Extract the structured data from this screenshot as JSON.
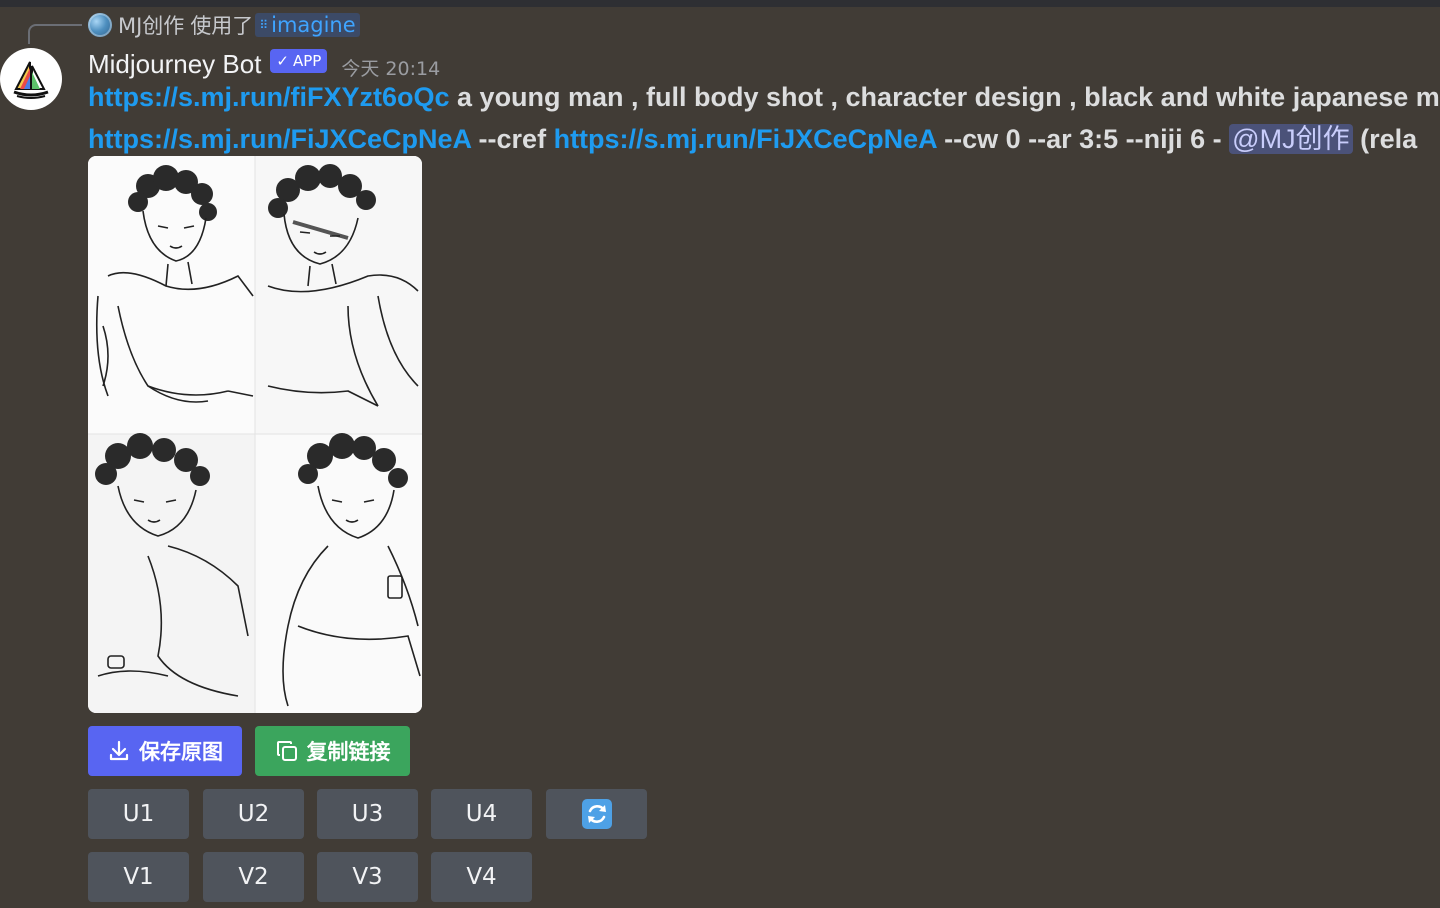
{
  "reply": {
    "user": "MJ创作",
    "used_text": "使用了",
    "command": "imagine"
  },
  "author": {
    "name": "Midjourney Bot",
    "badge": "APP",
    "timestamp": "今天 20:14"
  },
  "message": {
    "link1": "https://s.mj.run/fiFXYzt6oQc",
    "prompt_text": " a young man , full body shot , character design , black and white japanese m",
    "link2": "https://s.mj.run/FiJXCeCpNeA",
    "cref_text": " --cref ",
    "link3": "https://s.mj.run/FiJXCeCpNeA",
    "params_text": " --cw 0 --ar 3:5 --niji 6 - ",
    "mention": "@MJ创作",
    "tail_text": " (rela"
  },
  "actions": {
    "save_label": "保存原图",
    "copy_label": "复制链接"
  },
  "upscale_buttons": [
    "U1",
    "U2",
    "U3",
    "U4"
  ],
  "variation_buttons": [
    "V1",
    "V2",
    "V3",
    "V4"
  ],
  "colors": {
    "background": "#413c36",
    "link": "#1e9bf0",
    "save_button": "#5865f2",
    "copy_button": "#3ba55d",
    "grid_button": "#4f545c",
    "refresh_icon": "#4ea1e6"
  },
  "icons": {
    "save": "download-icon",
    "copy": "copy-icon",
    "reroll": "refresh-icon",
    "command": "slash-command-icon"
  }
}
